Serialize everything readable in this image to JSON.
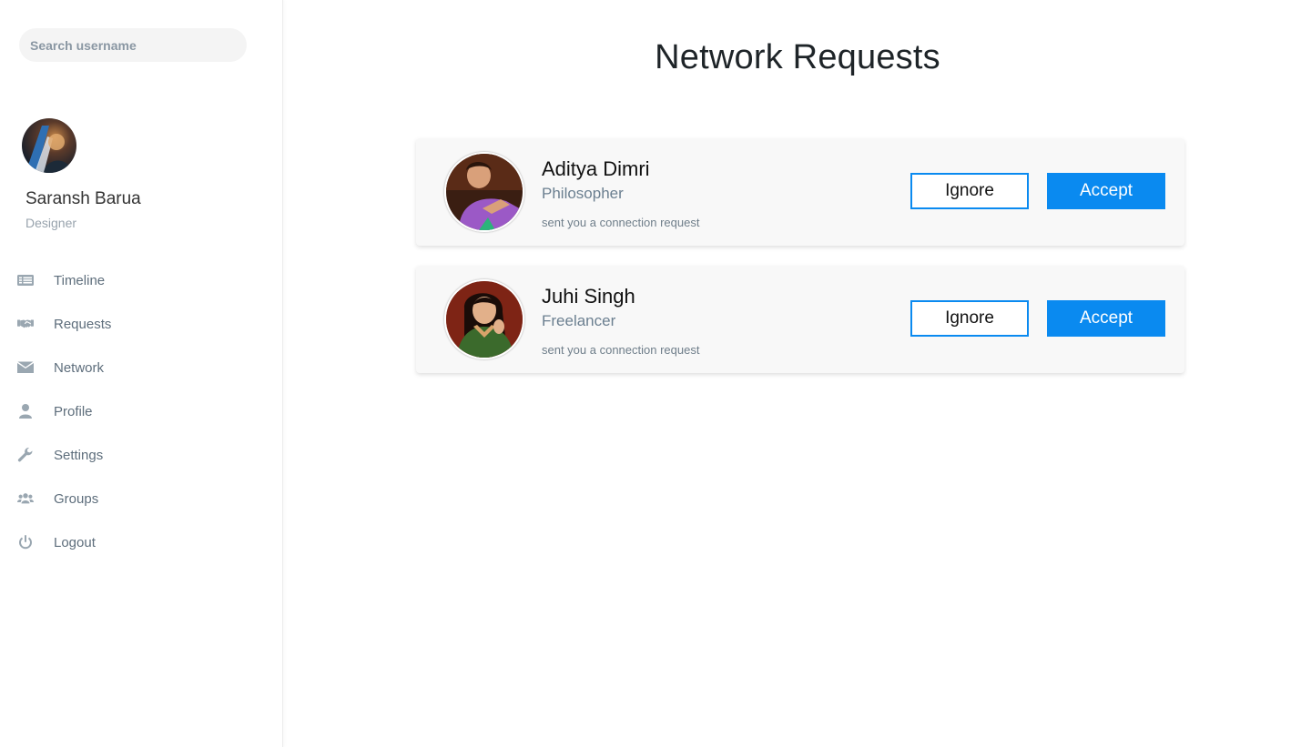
{
  "sidebar": {
    "search": {
      "placeholder": "Search username"
    },
    "user": {
      "name": "Saransh Barua",
      "role": "Designer"
    },
    "nav": [
      {
        "label": "Timeline",
        "icon": "list-icon"
      },
      {
        "label": "Requests",
        "icon": "handshake-icon"
      },
      {
        "label": "Network",
        "icon": "envelope-icon"
      },
      {
        "label": "Profile",
        "icon": "user-icon"
      },
      {
        "label": "Settings",
        "icon": "wrench-icon"
      },
      {
        "label": "Groups",
        "icon": "users-icon"
      },
      {
        "label": "Logout",
        "icon": "power-icon"
      }
    ]
  },
  "main": {
    "title": "Network Requests",
    "requests": [
      {
        "name": "Aditya Dimri",
        "title": "Philosopher",
        "message": "sent you a connection request",
        "ignore_label": "Ignore",
        "accept_label": "Accept"
      },
      {
        "name": "Juhi Singh",
        "title": "Freelancer",
        "message": "sent you a connection request",
        "ignore_label": "Ignore",
        "accept_label": "Accept"
      }
    ]
  },
  "colors": {
    "accent": "#0a8af0",
    "icon": "#9aa7b1",
    "nav_text": "#5e6e7c"
  }
}
